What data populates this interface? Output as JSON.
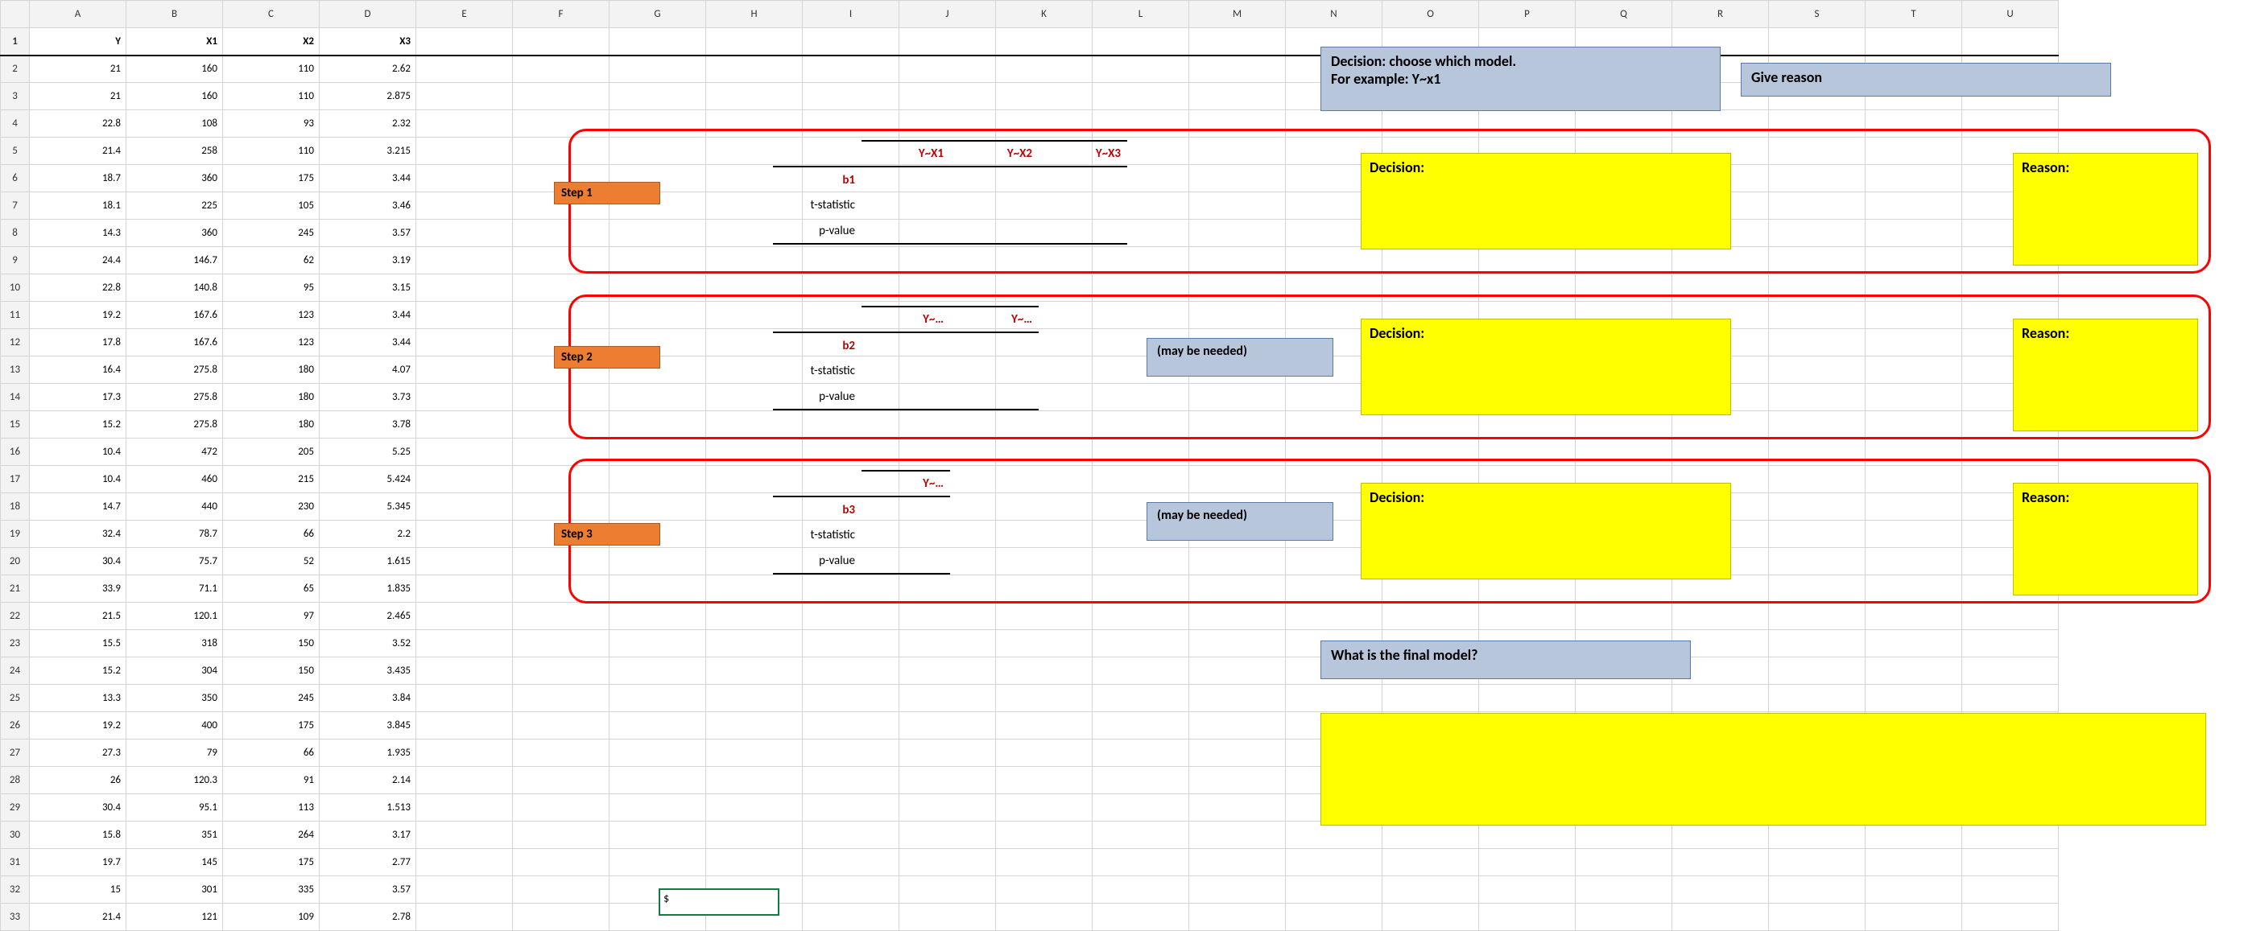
{
  "columns": [
    "A",
    "B",
    "C",
    "D",
    "E",
    "F",
    "G",
    "H",
    "I",
    "J",
    "K",
    "L",
    "M",
    "N",
    "O",
    "P",
    "Q",
    "R",
    "S",
    "T",
    "U"
  ],
  "rowcount": 33,
  "headers": {
    "A": "Y",
    "B": "X1",
    "C": "X2",
    "D": "X3"
  },
  "data": [
    {
      "Y": "21",
      "X1": "160",
      "X2": "110",
      "X3": "2.62"
    },
    {
      "Y": "21",
      "X1": "160",
      "X2": "110",
      "X3": "2.875"
    },
    {
      "Y": "22.8",
      "X1": "108",
      "X2": "93",
      "X3": "2.32"
    },
    {
      "Y": "21.4",
      "X1": "258",
      "X2": "110",
      "X3": "3.215"
    },
    {
      "Y": "18.7",
      "X1": "360",
      "X2": "175",
      "X3": "3.44"
    },
    {
      "Y": "18.1",
      "X1": "225",
      "X2": "105",
      "X3": "3.46"
    },
    {
      "Y": "14.3",
      "X1": "360",
      "X2": "245",
      "X3": "3.57"
    },
    {
      "Y": "24.4",
      "X1": "146.7",
      "X2": "62",
      "X3": "3.19"
    },
    {
      "Y": "22.8",
      "X1": "140.8",
      "X2": "95",
      "X3": "3.15"
    },
    {
      "Y": "19.2",
      "X1": "167.6",
      "X2": "123",
      "X3": "3.44"
    },
    {
      "Y": "17.8",
      "X1": "167.6",
      "X2": "123",
      "X3": "3.44"
    },
    {
      "Y": "16.4",
      "X1": "275.8",
      "X2": "180",
      "X3": "4.07"
    },
    {
      "Y": "17.3",
      "X1": "275.8",
      "X2": "180",
      "X3": "3.73"
    },
    {
      "Y": "15.2",
      "X1": "275.8",
      "X2": "180",
      "X3": "3.78"
    },
    {
      "Y": "10.4",
      "X1": "472",
      "X2": "205",
      "X3": "5.25"
    },
    {
      "Y": "10.4",
      "X1": "460",
      "X2": "215",
      "X3": "5.424"
    },
    {
      "Y": "14.7",
      "X1": "440",
      "X2": "230",
      "X3": "5.345"
    },
    {
      "Y": "32.4",
      "X1": "78.7",
      "X2": "66",
      "X3": "2.2"
    },
    {
      "Y": "30.4",
      "X1": "75.7",
      "X2": "52",
      "X3": "1.615"
    },
    {
      "Y": "33.9",
      "X1": "71.1",
      "X2": "65",
      "X3": "1.835"
    },
    {
      "Y": "21.5",
      "X1": "120.1",
      "X2": "97",
      "X3": "2.465"
    },
    {
      "Y": "15.5",
      "X1": "318",
      "X2": "150",
      "X3": "3.52"
    },
    {
      "Y": "15.2",
      "X1": "304",
      "X2": "150",
      "X3": "3.435"
    },
    {
      "Y": "13.3",
      "X1": "350",
      "X2": "245",
      "X3": "3.84"
    },
    {
      "Y": "19.2",
      "X1": "400",
      "X2": "175",
      "X3": "3.845"
    },
    {
      "Y": "27.3",
      "X1": "79",
      "X2": "66",
      "X3": "1.935"
    },
    {
      "Y": "26",
      "X1": "120.3",
      "X2": "91",
      "X3": "2.14"
    },
    {
      "Y": "30.4",
      "X1": "95.1",
      "X2": "113",
      "X3": "1.513"
    },
    {
      "Y": "15.8",
      "X1": "351",
      "X2": "264",
      "X3": "3.17"
    },
    {
      "Y": "19.7",
      "X1": "145",
      "X2": "175",
      "X3": "2.77"
    },
    {
      "Y": "15",
      "X1": "301",
      "X2": "335",
      "X3": "3.57"
    },
    {
      "Y": "21.4",
      "X1": "121",
      "X2": "109",
      "X3": "2.78"
    }
  ],
  "instructions": {
    "decision_header": "Decision: choose which model.\nFor example: Y~x1",
    "reason_header": "Give reason",
    "final_q": "What is the final model?"
  },
  "steps": {
    "s1": {
      "label": "Step 1",
      "col_headers": [
        "Y~X1",
        "Y~X2",
        "Y~X3"
      ],
      "rows": [
        "b1",
        "t-statistic",
        "p-value"
      ],
      "decision": "Decision:",
      "reason": "Reason:"
    },
    "s2": {
      "label": "Step 2",
      "col_headers": [
        "Y~…",
        "Y~…"
      ],
      "rows": [
        "b2",
        "t-statistic",
        "p-value"
      ],
      "note": "(may be needed)",
      "decision": "Decision:",
      "reason": "Reason:"
    },
    "s3": {
      "label": "Step 3",
      "col_headers": [
        "Y~…"
      ],
      "rows": [
        "b3",
        "t-statistic",
        "p-value"
      ],
      "note": "(may be needed)",
      "decision": "Decision:",
      "reason": "Reason:"
    }
  },
  "active_cell": {
    "ref": "G33",
    "value": "$"
  }
}
